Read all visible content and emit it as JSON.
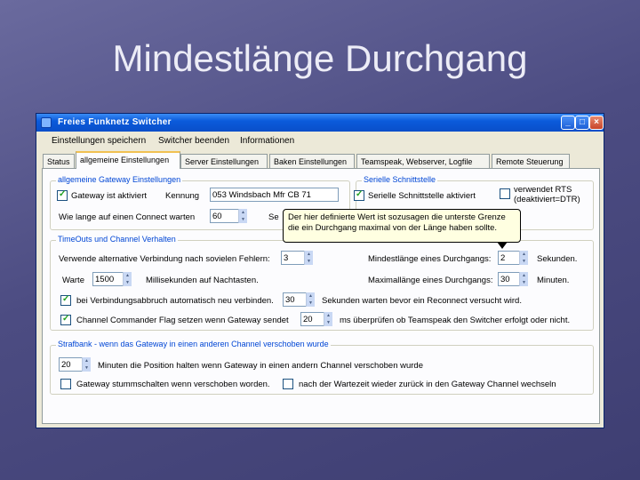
{
  "slide": {
    "title": "Mindestlänge Durchgang"
  },
  "window": {
    "title": "Freies Funknetz Switcher",
    "controls": {
      "minimize": "_",
      "maximize": "□",
      "close": "×"
    }
  },
  "menu": [
    "Einstellungen speichern",
    "Switcher beenden",
    "Informationen"
  ],
  "tabs": [
    "Status",
    "allgemeine Einstellungen",
    "Server Einstellungen",
    "Baken Einstellungen",
    "Teamspeak, Webserver, Logfile",
    "Remote Steuerung"
  ],
  "gateway_group": {
    "legend": "allgemeine Gateway Einstellungen",
    "gateway_active": "Gateway ist aktiviert",
    "kennung_label": "Kennung",
    "kennung_value": "053 Windsbach Mfr CB 71",
    "connect_label": "Wie lange auf einen Connect warten",
    "connect_value": "60",
    "connect_unit": "Se"
  },
  "serial_group": {
    "legend": "Serielle Schnittstelle",
    "serial_active": "Serielle Schnittstelle aktiviert",
    "rts_label_1": "verwendet RTS",
    "rts_label_2": "(deaktiviert=DTR)"
  },
  "tooltip": {
    "line1": "Der hier definierte Wert ist sozusagen die unterste Grenze",
    "line2": "die ein Durchgang maximal von der Länge haben sollte."
  },
  "timeouts_group": {
    "legend": "TimeOuts und Channel Verhalten",
    "alt_conn_label": "Verwende alternative Verbindung nach sovielen Fehlern:",
    "alt_conn_value": "3",
    "wait_label": "Warte",
    "wait_value": "1500",
    "wait_unit": "Millisekunden auf Nachtasten.",
    "reconnect_label": "bei Verbindungsabbruch automatisch neu verbinden.",
    "reconnect_value": "30",
    "reconnect_unit": "Sekunden warten bevor ein Reconnect versucht wird.",
    "commander_label": "Channel Commander Flag setzen wenn Gateway sendet",
    "commander_value": "20",
    "commander_unit": "ms überprüfen ob Teamspeak den Switcher erfolgt oder nicht.",
    "min_length_label": "Mindestlänge eines Durchgangs:",
    "min_length_value": "2",
    "min_length_unit": "Sekunden.",
    "max_length_label": "Maximallänge eines Durchgangs:",
    "max_length_value": "30",
    "max_length_unit": "Minuten."
  },
  "penalty_group": {
    "legend": "Strafbank - wenn das Gateway in einen anderen Channel verschoben wurde",
    "hold_value": "20",
    "hold_label": "Minuten die Position halten wenn Gateway in einen andern Channel verschoben wurde",
    "mute_label": "Gateway stummschalten wenn verschoben worden.",
    "return_label": "nach der Wartezeit wieder zurück in den Gateway Channel wechseln"
  },
  "colors": {
    "titlebar": "#0b5bdb",
    "window_bg": "#ece9d8",
    "slide_bg": "#4c4c82",
    "legend": "#0046d5",
    "tooltip_bg": "#ffffe1"
  }
}
